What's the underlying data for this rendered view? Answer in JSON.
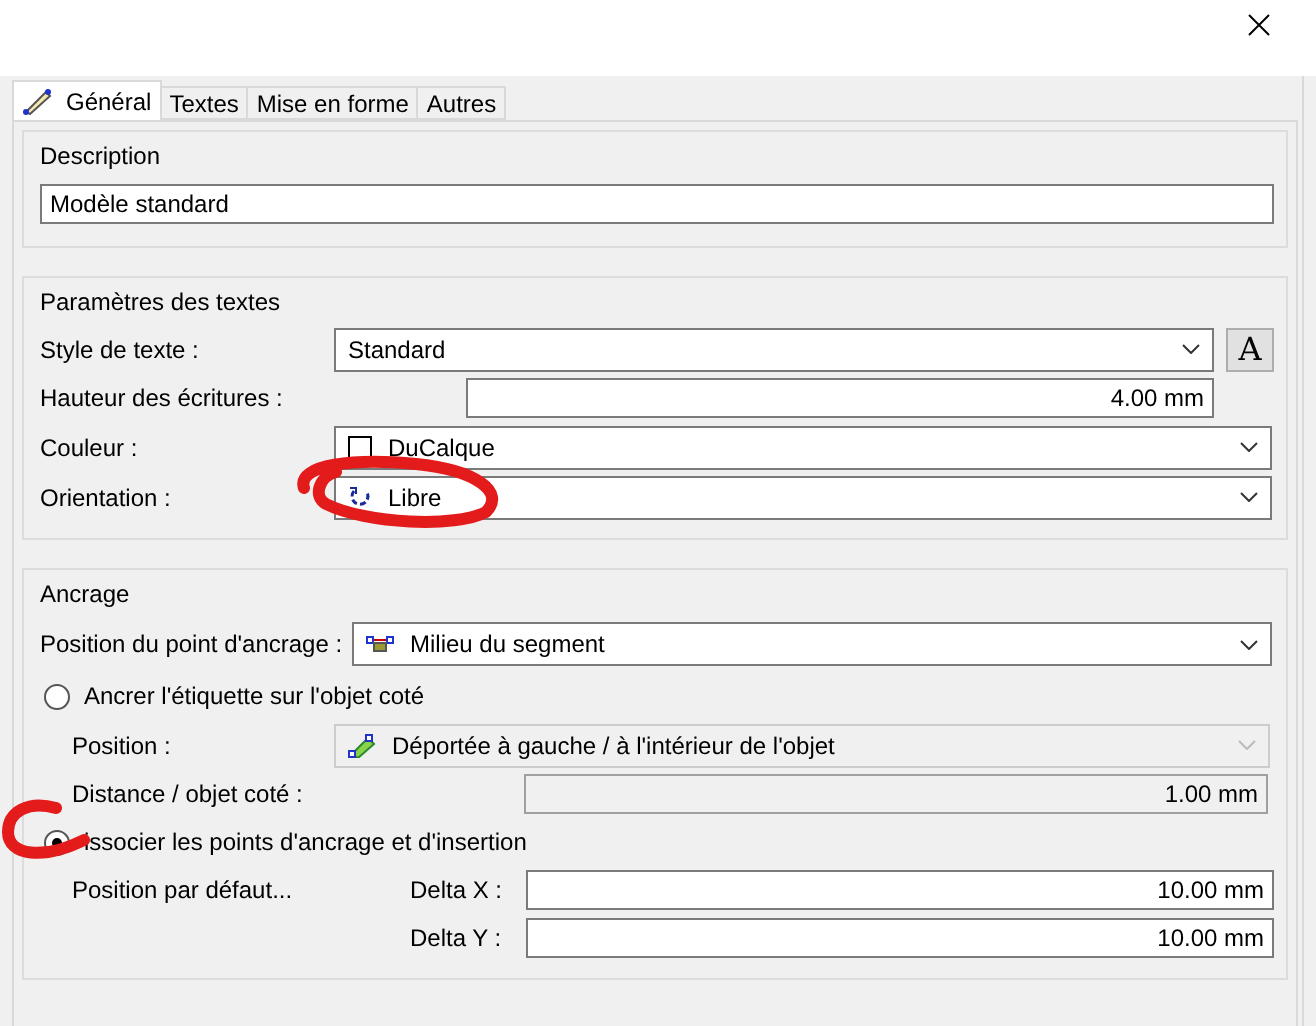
{
  "tabs": [
    {
      "label": "Général",
      "selected": true
    },
    {
      "label": "Textes",
      "selected": false
    },
    {
      "label": "Mise en forme",
      "selected": false
    },
    {
      "label": "Autres",
      "selected": false
    }
  ],
  "description": {
    "legend": "Description",
    "value": "Modèle standard"
  },
  "text_settings": {
    "legend": "Paramètres des textes",
    "style": {
      "label": "Style de texte :",
      "value": "Standard",
      "button": "A"
    },
    "height": {
      "label": "Hauteur des écritures :",
      "value": "4.00 mm"
    },
    "color": {
      "label": "Couleur :",
      "value": "DuCalque"
    },
    "orientation": {
      "label": "Orientation :",
      "value": "Libre"
    }
  },
  "anchoring": {
    "legend": "Ancrage",
    "anchor_point": {
      "label": "Position du point d'ancrage :",
      "value": "Milieu du segment"
    },
    "options": [
      {
        "label": "Ancrer l'étiquette sur l'objet coté",
        "selected": false
      },
      {
        "label": "issocier les points d'ancrage et d'insertion",
        "selected": true
      }
    ],
    "position": {
      "label": "Position :",
      "value": "Déportée à gauche / à l'intérieur de l'objet",
      "disabled": true
    },
    "distance": {
      "label": "Distance / objet coté :",
      "value": "1.00 mm",
      "disabled": true
    },
    "default_position": "Position par défaut...",
    "delta_x": {
      "label": "Delta X :",
      "value": "10.00 mm"
    },
    "delta_y": {
      "label": "Delta Y :",
      "value": "10.00 mm"
    }
  }
}
